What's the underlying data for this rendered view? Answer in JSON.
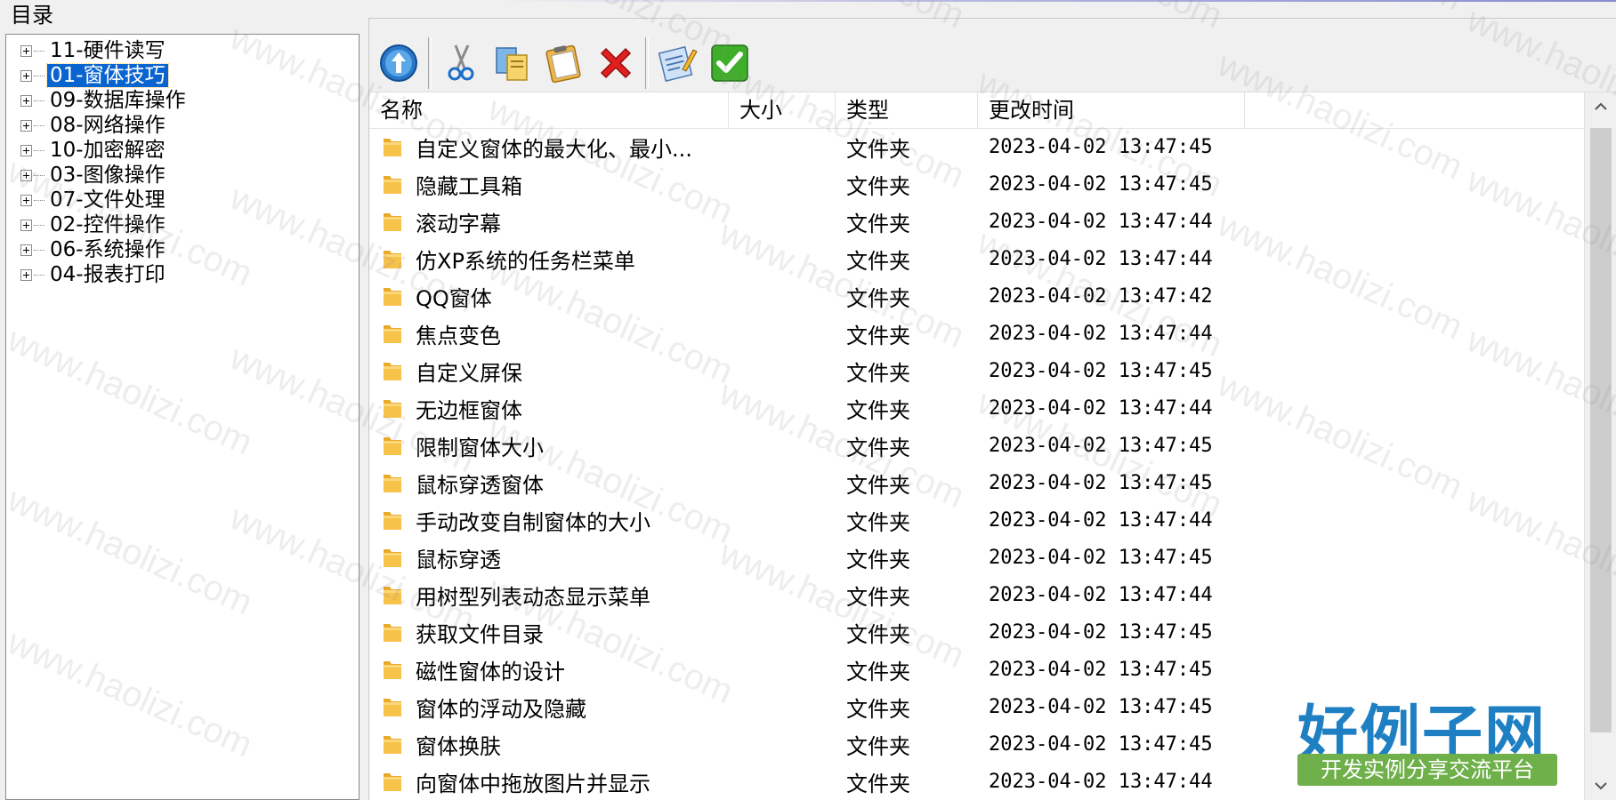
{
  "left_panel": {
    "title": "目录",
    "tree": [
      {
        "label": "11-硬件读写",
        "selected": false
      },
      {
        "label": "01-窗体技巧",
        "selected": true
      },
      {
        "label": "09-数据库操作",
        "selected": false
      },
      {
        "label": "08-网络操作",
        "selected": false
      },
      {
        "label": "10-加密解密",
        "selected": false
      },
      {
        "label": "03-图像操作",
        "selected": false
      },
      {
        "label": "07-文件处理",
        "selected": false
      },
      {
        "label": "02-控件操作",
        "selected": false
      },
      {
        "label": "06-系统操作",
        "selected": false
      },
      {
        "label": "04-报表打印",
        "selected": false
      }
    ]
  },
  "toolbar": {
    "buttons": [
      "up-icon",
      "cut-icon",
      "copy-icon",
      "paste-icon",
      "delete-icon",
      "rename-icon",
      "ok-icon"
    ]
  },
  "file_list": {
    "columns": {
      "name": "名称",
      "size": "大小",
      "type": "类型",
      "modified": "更改时间"
    },
    "rows": [
      {
        "name": "自定义窗体的最大化、最小...",
        "size": "",
        "type": "文件夹",
        "modified": "2023-04-02 13:47:45"
      },
      {
        "name": "隐藏工具箱",
        "size": "",
        "type": "文件夹",
        "modified": "2023-04-02 13:47:45"
      },
      {
        "name": "滚动字幕",
        "size": "",
        "type": "文件夹",
        "modified": "2023-04-02 13:47:44"
      },
      {
        "name": "仿XP系统的任务栏菜单",
        "size": "",
        "type": "文件夹",
        "modified": "2023-04-02 13:47:44"
      },
      {
        "name": "QQ窗体",
        "size": "",
        "type": "文件夹",
        "modified": "2023-04-02 13:47:42"
      },
      {
        "name": "焦点变色",
        "size": "",
        "type": "文件夹",
        "modified": "2023-04-02 13:47:44"
      },
      {
        "name": "自定义屏保",
        "size": "",
        "type": "文件夹",
        "modified": "2023-04-02 13:47:45"
      },
      {
        "name": "无边框窗体",
        "size": "",
        "type": "文件夹",
        "modified": "2023-04-02 13:47:44"
      },
      {
        "name": "限制窗体大小",
        "size": "",
        "type": "文件夹",
        "modified": "2023-04-02 13:47:45"
      },
      {
        "name": "鼠标穿透窗体",
        "size": "",
        "type": "文件夹",
        "modified": "2023-04-02 13:47:45"
      },
      {
        "name": "手动改变自制窗体的大小",
        "size": "",
        "type": "文件夹",
        "modified": "2023-04-02 13:47:44"
      },
      {
        "name": "鼠标穿透",
        "size": "",
        "type": "文件夹",
        "modified": "2023-04-02 13:47:45"
      },
      {
        "name": "用树型列表动态显示菜单",
        "size": "",
        "type": "文件夹",
        "modified": "2023-04-02 13:47:44"
      },
      {
        "name": "获取文件目录",
        "size": "",
        "type": "文件夹",
        "modified": "2023-04-02 13:47:45"
      },
      {
        "name": "磁性窗体的设计",
        "size": "",
        "type": "文件夹",
        "modified": "2023-04-02 13:47:45"
      },
      {
        "name": "窗体的浮动及隐藏",
        "size": "",
        "type": "文件夹",
        "modified": "2023-04-02 13:47:45"
      },
      {
        "name": "窗体换肤",
        "size": "",
        "type": "文件夹",
        "modified": "2023-04-02 13:47:45"
      },
      {
        "name": "向窗体中拖放图片并显示",
        "size": "",
        "type": "文件夹",
        "modified": "2023-04-02 13:47:44"
      }
    ]
  },
  "watermark": {
    "text": "www.haolizi.com",
    "logo_title": "好例子网",
    "logo_subtitle": "开发实例分享交流平台"
  },
  "colors": {
    "selection": "#0a64d0",
    "folder": "#f7c24a",
    "logo_blue": "#1e7fc3",
    "logo_green": "#6fb04a"
  }
}
